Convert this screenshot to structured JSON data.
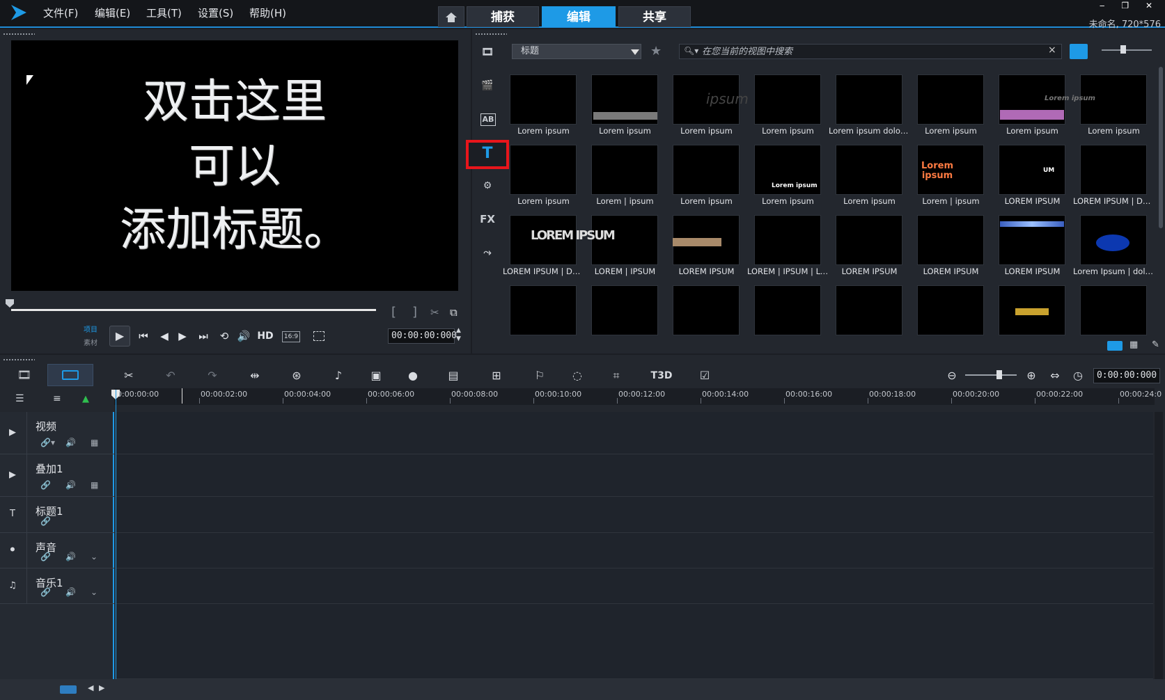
{
  "menu": [
    "文件(F)",
    "编辑(E)",
    "工具(T)",
    "设置(S)",
    "帮助(H)"
  ],
  "nav_tabs": [
    "捕获",
    "编辑",
    "共享"
  ],
  "window_controls": "‒ ❐ ✕",
  "project_info": "未命名, 720*576",
  "preview": {
    "title_lines": [
      "双击这里",
      "可以",
      "添加标题。"
    ],
    "project_label": "项目",
    "clip_label": "素材",
    "hd_label": "HD",
    "aspect_label": "16:9",
    "timecode": "00:00:00:000"
  },
  "library": {
    "category": "标题",
    "search_placeholder": "在您当前的视图中搜索",
    "side_icons": {
      "text": "T",
      "fx": "FX",
      "ab": "AB"
    },
    "thumbnails": [
      [
        "Lorem ipsum",
        "Lorem ipsum",
        "Lorem ipsum",
        "Lorem ipsum",
        "Lorem ipsum dolor sit ...",
        "Lorem ipsum",
        "Lorem ipsum",
        "Lorem ipsum"
      ],
      [
        "Lorem ipsum",
        "Lorem | ipsum",
        "Lorem ipsum",
        "Lorem ipsum",
        "Lorem ipsum",
        "Lorem | ipsum",
        "LOREM IPSUM",
        "LOREM IPSUM | DOL..."
      ],
      [
        "LOREM IPSUM | DOL...",
        "LOREM | IPSUM",
        "LOREM IPSUM",
        "LOREM | IPSUM | LO...",
        "LOREM IPSUM",
        "LOREM IPSUM",
        "LOREM IPSUM",
        "Lorem Ipsum | dolor si..."
      ],
      [
        "",
        "",
        "",
        "",
        "",
        "",
        "",
        ""
      ]
    ],
    "thumb_texts": {
      "r1c8": "Lorem ipsum",
      "r2c4": "Lorem ipsum",
      "r2c6": "Lorem ipsum",
      "r2c7": "UM",
      "r3c1": "LOREM IPSUM",
      "r1c3": "ipsum"
    }
  },
  "timeline": {
    "timecode": "0:00:00:000",
    "ruler": [
      "0:00:00:00",
      "00:00:02:00",
      "00:00:04:00",
      "00:00:06:00",
      "00:00:08:00",
      "00:00:10:00",
      "00:00:12:00",
      "00:00:14:00",
      "00:00:16:00",
      "00:00:18:00",
      "00:00:20:00",
      "00:00:22:00",
      "00:00:24:0"
    ],
    "tracks": [
      "视频",
      "叠加1",
      "标题1",
      "声音",
      "音乐1"
    ],
    "tool_3d": "T3D"
  },
  "colors": {
    "accent": "#1e9ae6",
    "selection": "#e8151b"
  }
}
